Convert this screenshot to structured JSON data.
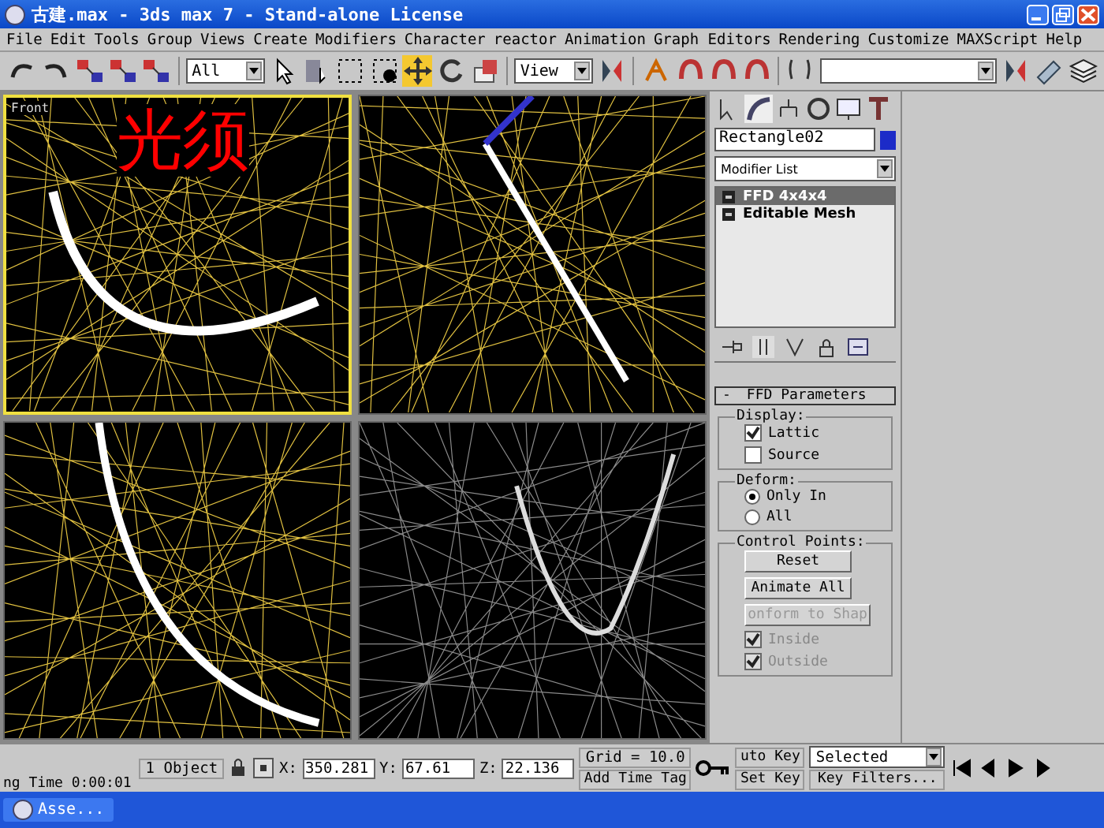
{
  "window": {
    "title": "古建.max - 3ds max 7  - Stand-alone License"
  },
  "menu": [
    "File",
    "Edit",
    "Tools",
    "Group",
    "Views",
    "Create",
    "Modifiers",
    "Character",
    "reactor",
    "Animation",
    "Graph Editors",
    "Rendering",
    "Customize",
    "MAXScript",
    "Help"
  ],
  "toolbar": {
    "selection_filter": "All",
    "reference_coord": "View"
  },
  "viewports": [
    {
      "label": "Front",
      "selected": true,
      "annotation": "光须"
    },
    {
      "selected": false
    },
    {
      "selected": false
    },
    {
      "selected": false
    }
  ],
  "command_panel": {
    "object_name": "Rectangle02",
    "modifier_list": "Modifier List",
    "stack": [
      {
        "label": "FFD 4x4x4",
        "selected": true
      },
      {
        "label": "Editable Mesh",
        "selected": false
      }
    ],
    "rollout": {
      "toggle": "-",
      "title": "FFD Parameters",
      "groups": [
        {
          "title": "Display:",
          "items": [
            {
              "kind": "checkbox",
              "label": "Lattic",
              "checked": true,
              "disabled": false
            },
            {
              "kind": "checkbox",
              "label": "Source",
              "checked": false,
              "disabled": false
            }
          ]
        },
        {
          "title": "Deform:",
          "items": [
            {
              "kind": "radio",
              "label": "Only In",
              "selected": true,
              "disabled": false
            },
            {
              "kind": "radio",
              "label": "All",
              "selected": false,
              "disabled": false
            }
          ]
        },
        {
          "title": "Control Points:",
          "items": [
            {
              "kind": "button",
              "label": "Reset",
              "disabled": false
            },
            {
              "kind": "button",
              "label": "Animate All",
              "disabled": false
            },
            {
              "kind": "button",
              "label": "onform to Shap",
              "disabled": true
            },
            {
              "kind": "checkbox",
              "label": "Inside",
              "checked": true,
              "disabled": true
            },
            {
              "kind": "checkbox",
              "label": "Outside",
              "checked": true,
              "disabled": true
            }
          ]
        }
      ]
    }
  },
  "status_bar": {
    "selection": "1 Object",
    "coords": [
      {
        "axis": "X:",
        "value": "350.281"
      },
      {
        "axis": "Y:",
        "value": "67.61"
      },
      {
        "axis": "Z:",
        "value": "22.136"
      }
    ],
    "grid": "Grid = 10.0",
    "time": "ng Time  0:00:01",
    "add_time_tag": "Add Time Tag",
    "auto_key": "uto Key",
    "key_mode": "Selected",
    "set_key": "Set Key",
    "key_filters": "Key Filters..."
  },
  "taskbar": {
    "window": "Asse..."
  }
}
